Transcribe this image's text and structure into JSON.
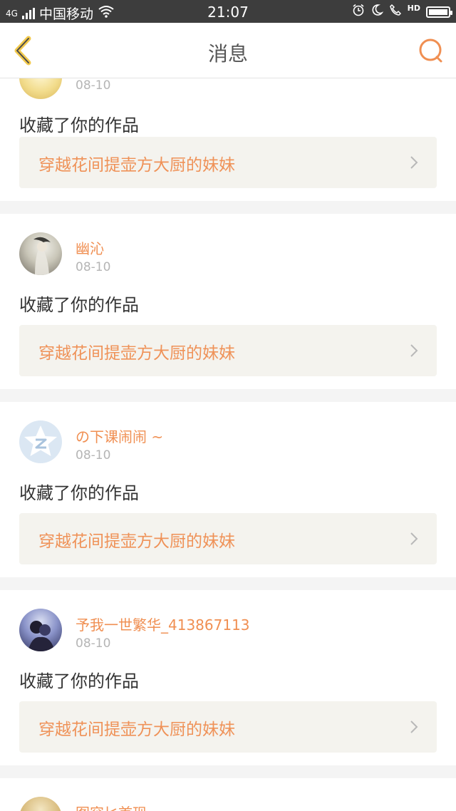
{
  "status_bar": {
    "signal": "4G",
    "carrier": "中国移动",
    "time": "21:07",
    "hd": "HD",
    "icons": [
      "wifi-icon",
      "alarm-icon",
      "moon-icon",
      "call-icon",
      "battery-icon"
    ]
  },
  "header": {
    "title": "消息",
    "back_icon": "chevron-left-icon",
    "search_icon": "search-icon"
  },
  "colors": {
    "accent": "#f08f52",
    "back_icon": "#f2c94c",
    "work_background": "#f4f3ee"
  },
  "messages": [
    {
      "username": "",
      "date": "08-10",
      "action": "收藏了你的作品",
      "work_title": "穿越花间提壶方大厨的妹妹"
    },
    {
      "username": "幽沁",
      "date": "08-10",
      "action": "收藏了你的作品",
      "work_title": "穿越花间提壶方大厨的妹妹"
    },
    {
      "username": "の下课闹闹 ~",
      "date": "08-10",
      "action": "收藏了你的作品",
      "work_title": "穿越花间提壶方大厨的妹妹"
    },
    {
      "username": "予我一世繁华_413867113",
      "date": "08-10",
      "action": "收藏了你的作品",
      "work_title": "穿越花间提壶方大厨的妹妹"
    },
    {
      "username": "图容匕首现",
      "date": "",
      "action": "",
      "work_title": ""
    }
  ]
}
